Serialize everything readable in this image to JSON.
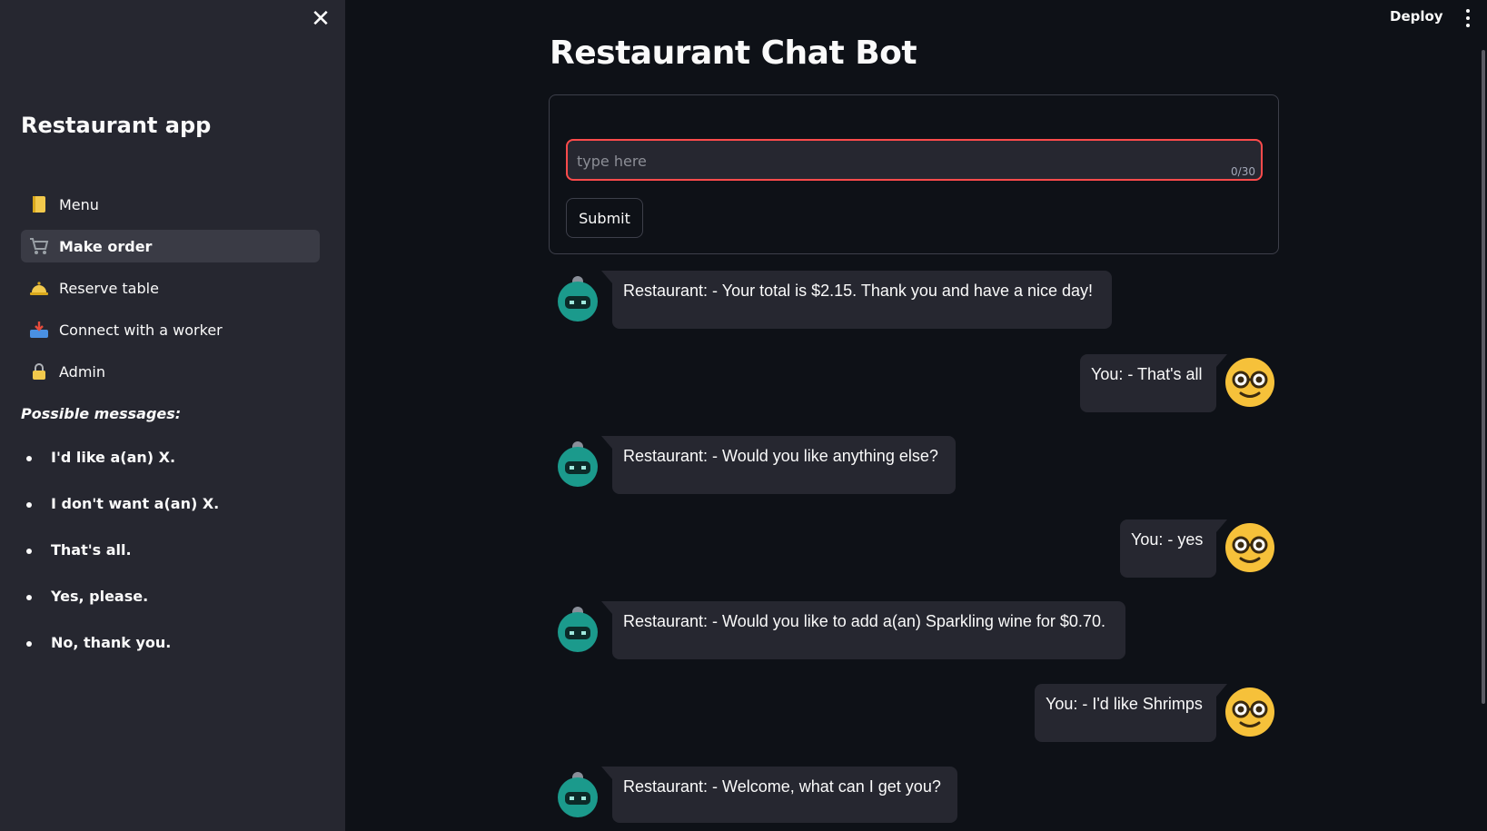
{
  "sidebar": {
    "close_icon": "close-icon",
    "app_title": "Restaurant app",
    "nav": [
      {
        "label": "Menu",
        "icon": "notebook-icon",
        "active": false
      },
      {
        "label": "Make order",
        "icon": "shopping-cart-icon",
        "active": true
      },
      {
        "label": "Reserve table",
        "icon": "bellhop-bell-icon",
        "active": false
      },
      {
        "label": "Connect with a worker",
        "icon": "inbox-tray-icon",
        "active": false
      },
      {
        "label": "Admin",
        "icon": "lock-icon",
        "active": false
      }
    ],
    "possible_title": "Possible messages:",
    "possible_messages": [
      "I'd like a(an) X.",
      "I don't want a(an) X.",
      "That's all.",
      "Yes, please.",
      "No, thank you."
    ]
  },
  "header": {
    "deploy_label": "Deploy",
    "menu_icon": "more-vertical-icon"
  },
  "main": {
    "title": "Restaurant Chat Bot",
    "input": {
      "placeholder": "type here",
      "value": "",
      "counter": "0/30"
    },
    "submit_label": "Submit"
  },
  "messages": [
    {
      "role": "bot",
      "text": "Restaurant: - Your total is $2.15. Thank you and have a nice day!"
    },
    {
      "role": "user",
      "text": "You: - That's all"
    },
    {
      "role": "bot",
      "text": "Restaurant: - Would you like anything else?"
    },
    {
      "role": "user",
      "text": "You: - yes"
    },
    {
      "role": "bot",
      "text": "Restaurant: - Would you like to add a(an) Sparkling wine for $0.70."
    },
    {
      "role": "user",
      "text": "You: - I'd like Shrimps"
    },
    {
      "role": "bot",
      "text": "Restaurant: - Welcome, what can I get you?"
    }
  ],
  "colors": {
    "background": "#0e1117",
    "sidebar": "#262730",
    "accent": "#ff4b4b",
    "bubble": "#262730",
    "bot_avatar": "#1b9a8c",
    "user_avatar": "#f6c13a"
  }
}
